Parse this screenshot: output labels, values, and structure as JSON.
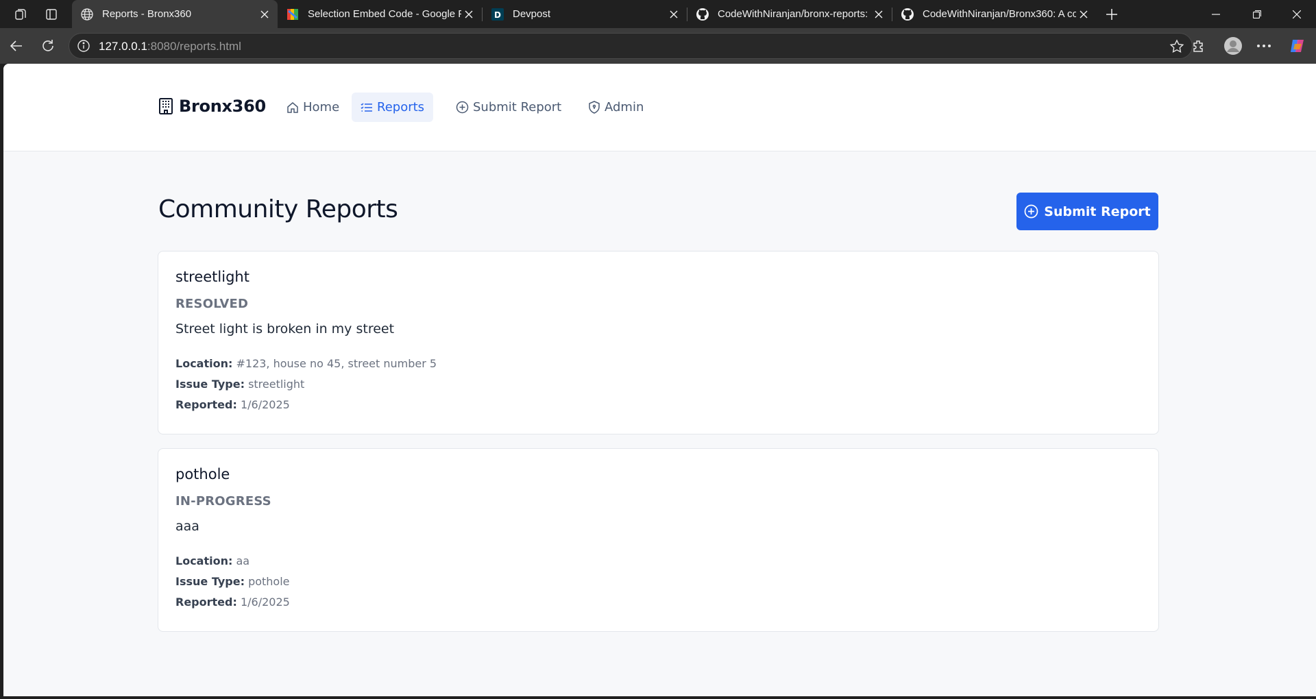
{
  "browser": {
    "tabs": [
      {
        "title": "Reports - Bronx360",
        "favicon": "globe-icon",
        "active": true
      },
      {
        "title": "Selection Embed Code - Google F",
        "favicon": "google-icon",
        "active": false
      },
      {
        "title": "Devpost",
        "favicon": "devpost-icon",
        "active": false
      },
      {
        "title": "CodeWithNiranjan/bronx-reports:",
        "favicon": "github-icon",
        "active": false
      },
      {
        "title": "CodeWithNiranjan/Bronx360: A co",
        "favicon": "github-icon",
        "active": false
      }
    ],
    "url_host": "127.0.0.1",
    "url_rest": ":8080/reports.html"
  },
  "nav": {
    "brand": "Bronx360",
    "links": [
      {
        "label": "Home",
        "icon": "home-icon"
      },
      {
        "label": "Reports",
        "icon": "list-icon",
        "active": true
      },
      {
        "label": "Submit Report",
        "icon": "plus-circle-icon"
      },
      {
        "label": "Admin",
        "icon": "shield-icon"
      }
    ]
  },
  "main": {
    "title": "Community Reports",
    "submit_button": "Submit Report",
    "labels": {
      "location": "Location:",
      "issue_type": "Issue Type:",
      "reported": "Reported:"
    },
    "reports": [
      {
        "title": "streetlight",
        "status": "RESOLVED",
        "description": "Street light is broken in my street",
        "location": "#123, house no 45, street number 5",
        "issue_type": "streetlight",
        "reported": "1/6/2025"
      },
      {
        "title": "pothole",
        "status": "IN-PROGRESS",
        "description": "aaa",
        "location": "aa",
        "issue_type": "pothole",
        "reported": "1/6/2025"
      }
    ]
  },
  "colors": {
    "primary": "#2563eb",
    "page_bg": "#f7f8fa",
    "muted": "#6b7280"
  }
}
